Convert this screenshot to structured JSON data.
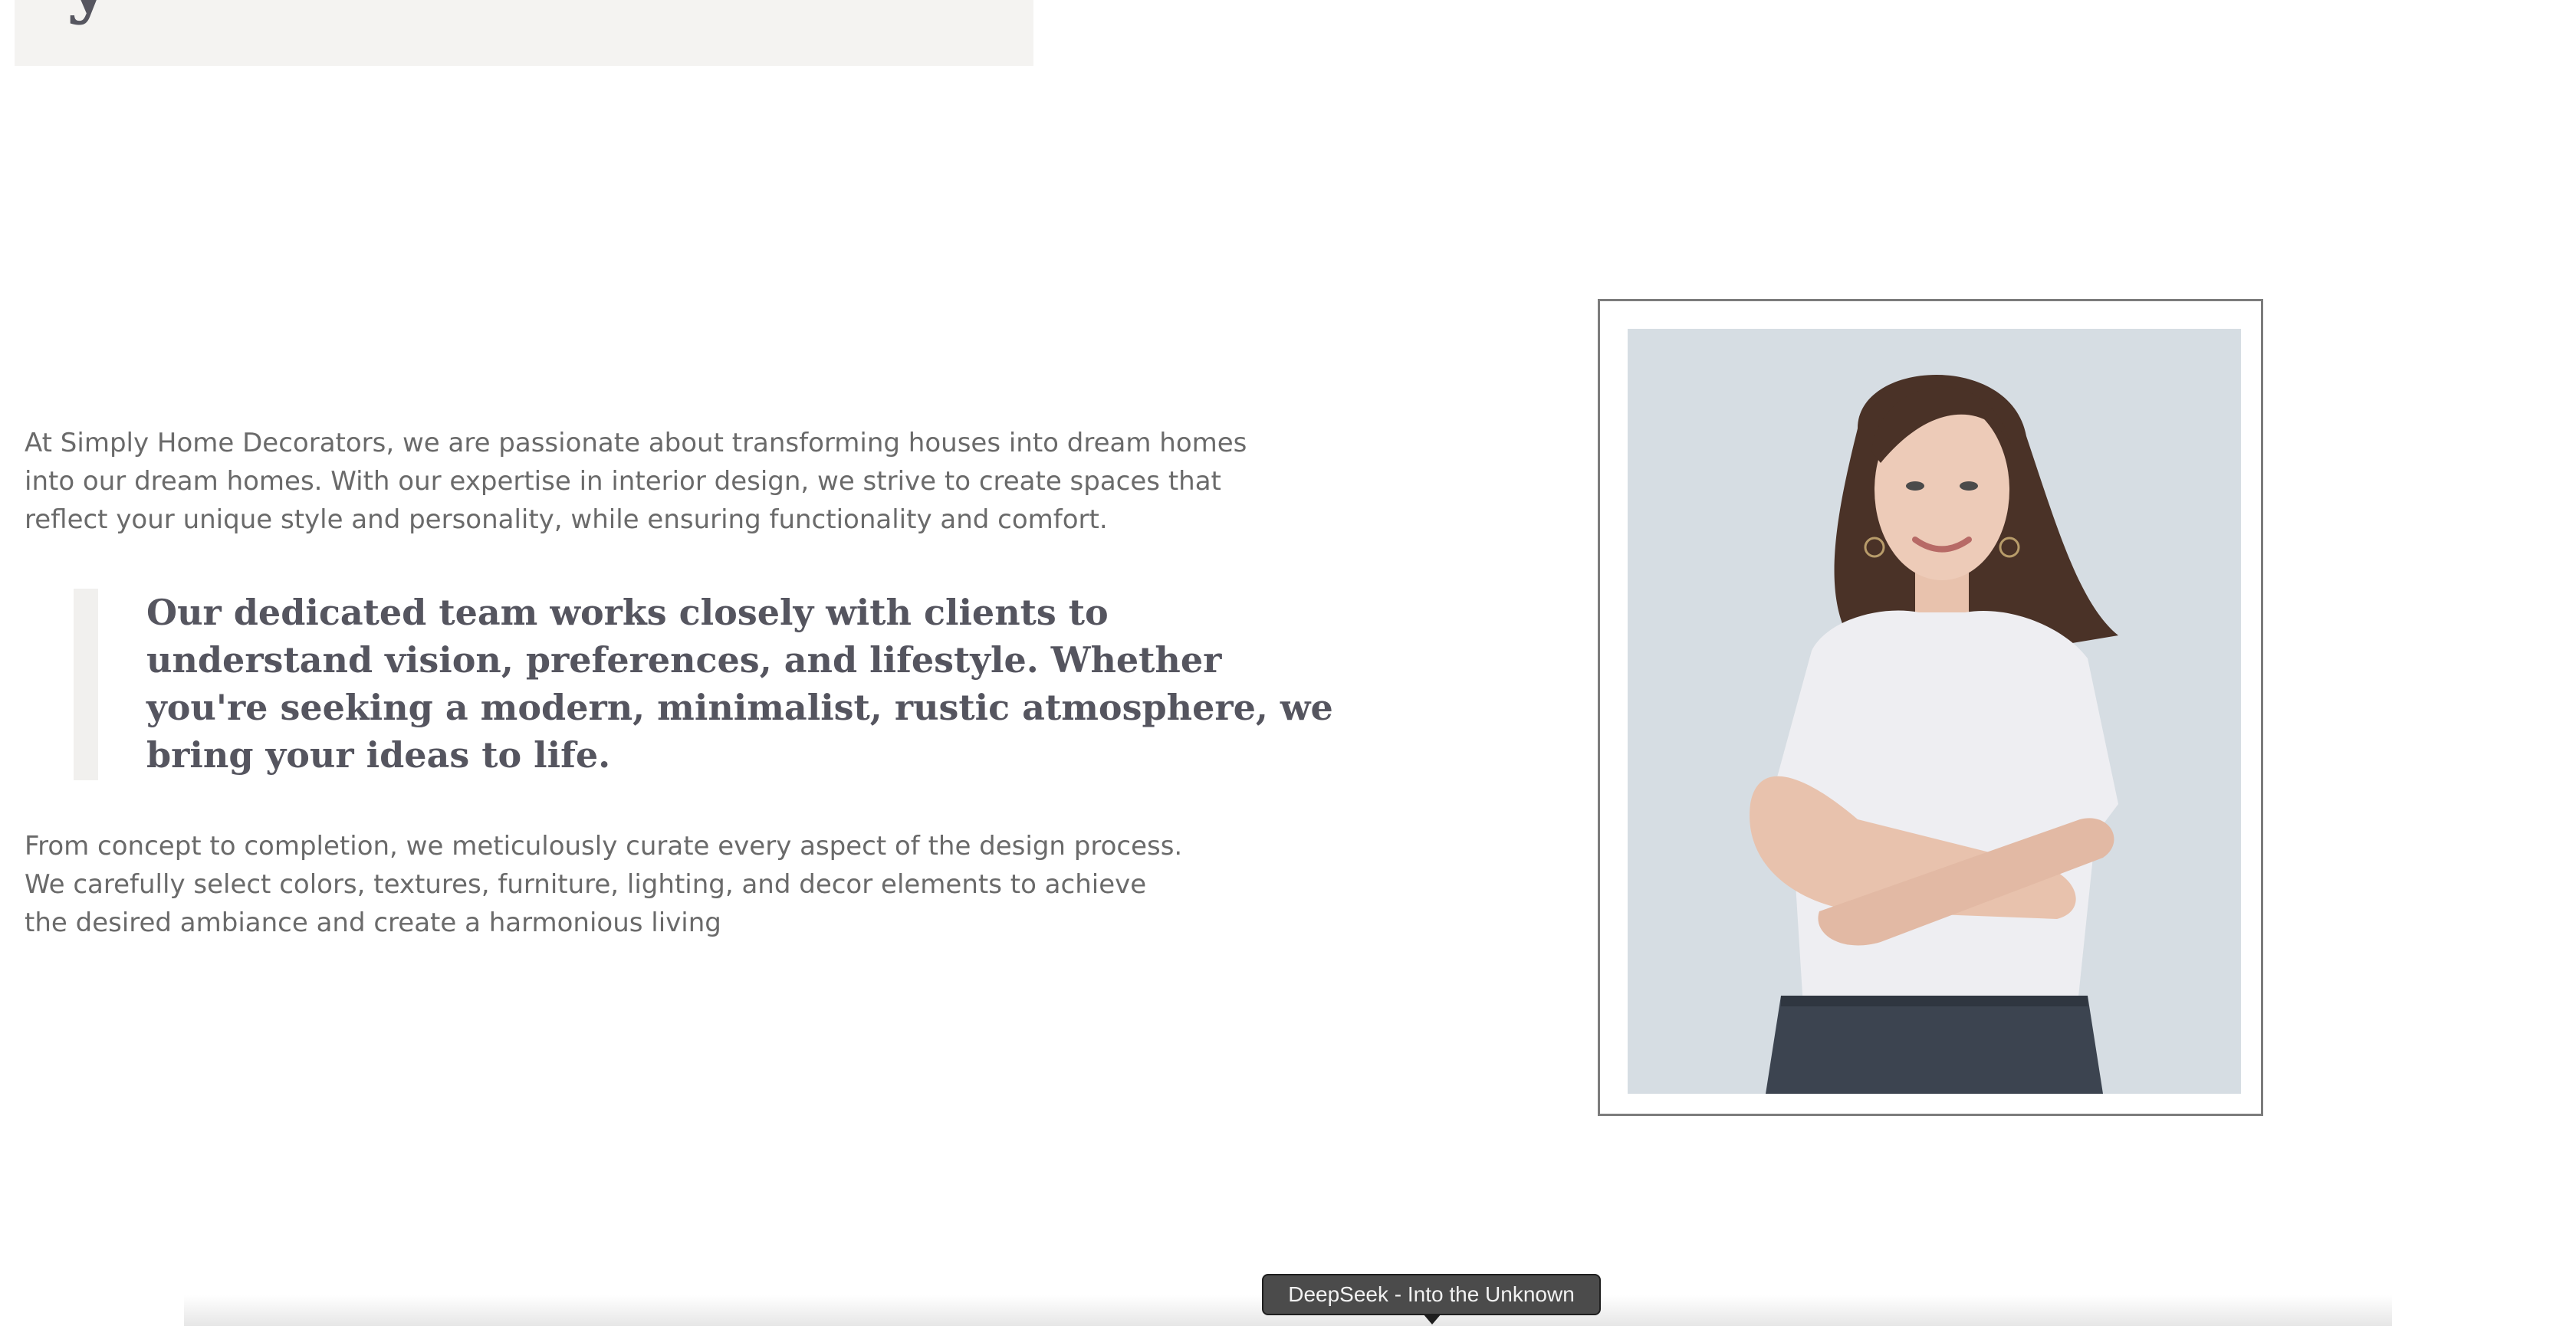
{
  "banner": {
    "heading_fragment": "y"
  },
  "content": {
    "intro": "At Simply Home Decorators, we are passionate about transforming houses into dream homes into our dream homes. With our expertise in interior design, we strive to create spaces that reflect your unique style and personality, while ensuring functionality and comfort.",
    "quote": "Our dedicated team works closely with clients to understand vision, preferences, and lifestyle. Whether you're seeking a modern, minimalist, rustic atmosphere, we bring your ideas to life.",
    "closing": "From concept to completion, we meticulously curate every aspect of the design process. We carefully select colors, textures, furniture, lighting, and decor elements to achieve the desired ambiance and create a harmonious living"
  },
  "tooltip": {
    "text": "DeepSeek - Into the Unknown"
  },
  "colors": {
    "banner_bg": "#f4f3f1",
    "body_text": "#6a6a6a",
    "quote_text": "#55555f",
    "quote_bar": "#f1f0ee",
    "frame_border": "#7c7c7c",
    "photo_bg": "#d6dde3",
    "tooltip_bg": "#4b4b4b"
  }
}
